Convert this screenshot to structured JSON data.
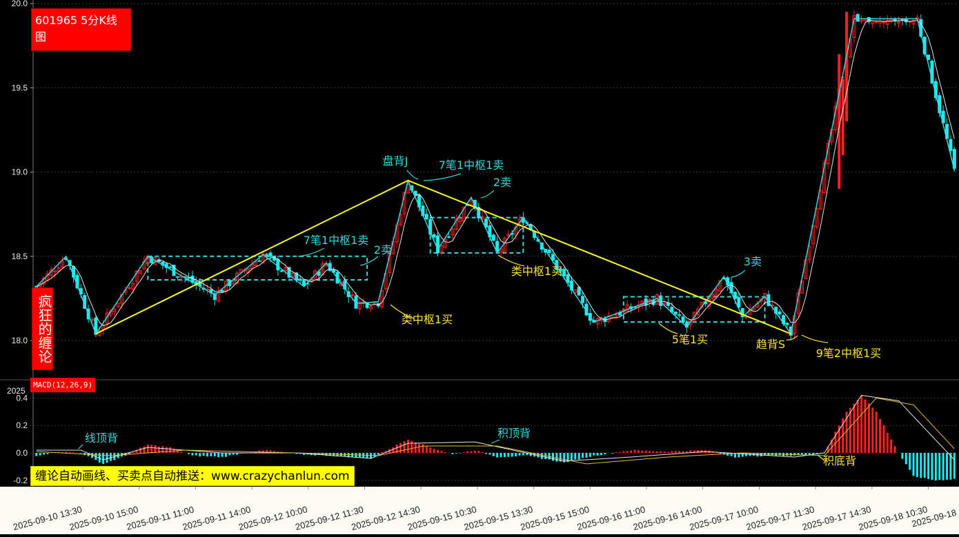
{
  "stock_title": "601965 5分K线图",
  "side_badge": "疯狂的缠论",
  "macd_label": "MACD(12,26,9)",
  "promo_text": "缠论自动画线、买卖点自动推送：www.crazychanlun.com",
  "colors": {
    "background": "#000000",
    "up_candle": "#ff2020",
    "down_candle": "#22e8f0",
    "stroke_lines": "#35d8dc",
    "segment_lines": "#ffff20",
    "zone_boxes": "#35d8dc",
    "annotation_cyan": "#35d8dc",
    "annotation_yellow": "#ffe040",
    "ma_line": "#e8e8e8",
    "dif_line": "#e8e8e8",
    "dea_line": "#e0c030"
  },
  "chart_data": [
    {
      "type": "candlestick",
      "name": "price",
      "y_ticks": [
        "20.0",
        "19.5",
        "19.0",
        "18.5",
        "18.0"
      ],
      "ylim": [
        17.8,
        20.0
      ],
      "x_ticks": [
        "2025-09-10 13:30",
        "2025-09-10 15:00",
        "2025-09-11 11:00",
        "2025-09-11 14:00",
        "2025-09-12 10:00",
        "2025-09-12 11:30",
        "2025-09-12 14:30",
        "2025-09-15 10:30",
        "2025-09-15 13:30",
        "2025-09-15 15:00",
        "2025-09-16 11:00",
        "2025-09-16 14:00",
        "2025-09-17 10:00",
        "2025-09-17 11:30",
        "2025-09-17 14:30",
        "2025-09-18 10:30",
        "2025-09-18"
      ],
      "extra_tick": "2025",
      "stroke_points": [
        {
          "i": 0,
          "v": 18.32
        },
        {
          "i": 8,
          "v": 18.5
        },
        {
          "i": 16,
          "v": 18.04
        },
        {
          "i": 30,
          "v": 18.5
        },
        {
          "i": 48,
          "v": 18.27
        },
        {
          "i": 61,
          "v": 18.51
        },
        {
          "i": 72,
          "v": 18.32
        },
        {
          "i": 78,
          "v": 18.46
        },
        {
          "i": 86,
          "v": 18.22
        },
        {
          "i": 92,
          "v": 18.23
        },
        {
          "i": 100,
          "v": 18.95
        },
        {
          "i": 108,
          "v": 18.54
        },
        {
          "i": 117,
          "v": 18.85
        },
        {
          "i": 124,
          "v": 18.52
        },
        {
          "i": 131,
          "v": 18.73
        },
        {
          "i": 150,
          "v": 18.11
        },
        {
          "i": 167,
          "v": 18.25
        },
        {
          "i": 175,
          "v": 18.08
        },
        {
          "i": 185,
          "v": 18.38
        },
        {
          "i": 190,
          "v": 18.14
        },
        {
          "i": 196,
          "v": 18.26
        },
        {
          "i": 203,
          "v": 18.04
        },
        {
          "i": 220,
          "v": 19.91
        },
        {
          "i": 237,
          "v": 19.91
        },
        {
          "i": 247,
          "v": 19.01
        }
      ],
      "segment_points": [
        {
          "i": 16,
          "v": 18.04
        },
        {
          "i": 100,
          "v": 18.95
        },
        {
          "i": 203,
          "v": 18.04
        }
      ],
      "zones": [
        {
          "i0": 30,
          "i1": 89,
          "lo": 18.36,
          "hi": 18.5
        },
        {
          "i0": 106,
          "i1": 131,
          "lo": 18.52,
          "hi": 18.73
        },
        {
          "i0": 158,
          "i1": 196,
          "lo": 18.11,
          "hi": 18.26
        }
      ],
      "annotations": [
        {
          "text": "7笔1中枢1卖",
          "color": "cyan"
        },
        {
          "text": "2卖",
          "color": "cyan"
        },
        {
          "text": "类中枢1买",
          "color": "yellow"
        },
        {
          "text": "盘背J",
          "color": "cyan"
        },
        {
          "text": "7笔1中枢1卖",
          "color": "cyan"
        },
        {
          "text": "2卖",
          "color": "cyan"
        },
        {
          "text": "类中枢1买",
          "color": "yellow"
        },
        {
          "text": "3卖",
          "color": "cyan"
        },
        {
          "text": "5笔1买",
          "color": "yellow"
        },
        {
          "text": "趋背S",
          "color": "yellow"
        },
        {
          "text": "9笔2中枢1买",
          "color": "yellow"
        }
      ]
    },
    {
      "type": "bar",
      "name": "MACD",
      "y_ticks": [
        "0.4",
        "0.2",
        "0.0",
        "-0.2"
      ],
      "ylim": [
        -0.25,
        0.45
      ],
      "hist_keypoints": [
        {
          "i": 0,
          "v": -0.02
        },
        {
          "i": 6,
          "v": 0.01
        },
        {
          "i": 12,
          "v": 0.0
        },
        {
          "i": 18,
          "v": -0.08
        },
        {
          "i": 24,
          "v": -0.02
        },
        {
          "i": 30,
          "v": 0.06
        },
        {
          "i": 36,
          "v": 0.04
        },
        {
          "i": 42,
          "v": -0.02
        },
        {
          "i": 50,
          "v": -0.03
        },
        {
          "i": 56,
          "v": 0.0
        },
        {
          "i": 62,
          "v": 0.02
        },
        {
          "i": 70,
          "v": -0.01
        },
        {
          "i": 80,
          "v": -0.02
        },
        {
          "i": 90,
          "v": -0.04
        },
        {
          "i": 100,
          "v": 0.1
        },
        {
          "i": 106,
          "v": 0.04
        },
        {
          "i": 112,
          "v": -0.01
        },
        {
          "i": 118,
          "v": 0.02
        },
        {
          "i": 124,
          "v": -0.03
        },
        {
          "i": 132,
          "v": -0.02
        },
        {
          "i": 142,
          "v": -0.07
        },
        {
          "i": 150,
          "v": -0.02
        },
        {
          "i": 160,
          "v": 0.02
        },
        {
          "i": 170,
          "v": 0.01
        },
        {
          "i": 180,
          "v": 0.02
        },
        {
          "i": 188,
          "v": -0.03
        },
        {
          "i": 196,
          "v": -0.02
        },
        {
          "i": 204,
          "v": -0.02
        },
        {
          "i": 212,
          "v": 0.0
        },
        {
          "i": 218,
          "v": 0.3
        },
        {
          "i": 222,
          "v": 0.42
        },
        {
          "i": 226,
          "v": 0.3
        },
        {
          "i": 232,
          "v": 0.0
        },
        {
          "i": 236,
          "v": -0.17
        },
        {
          "i": 242,
          "v": -0.2
        },
        {
          "i": 247,
          "v": -0.19
        }
      ],
      "dif_keypoints": [
        {
          "i": 0,
          "v": 0.02
        },
        {
          "i": 12,
          "v": 0.02
        },
        {
          "i": 18,
          "v": -0.05
        },
        {
          "i": 30,
          "v": 0.04
        },
        {
          "i": 50,
          "v": 0.0
        },
        {
          "i": 70,
          "v": 0.0
        },
        {
          "i": 90,
          "v": -0.04
        },
        {
          "i": 100,
          "v": 0.07
        },
        {
          "i": 118,
          "v": 0.08
        },
        {
          "i": 142,
          "v": -0.06
        },
        {
          "i": 160,
          "v": -0.03
        },
        {
          "i": 180,
          "v": 0.01
        },
        {
          "i": 204,
          "v": -0.03
        },
        {
          "i": 212,
          "v": 0.0
        },
        {
          "i": 222,
          "v": 0.42
        },
        {
          "i": 232,
          "v": 0.38
        },
        {
          "i": 247,
          "v": -0.05
        }
      ],
      "dea_keypoints": [
        {
          "i": 0,
          "v": 0.01
        },
        {
          "i": 20,
          "v": -0.02
        },
        {
          "i": 40,
          "v": 0.02
        },
        {
          "i": 70,
          "v": 0.0
        },
        {
          "i": 92,
          "v": -0.02
        },
        {
          "i": 104,
          "v": 0.05
        },
        {
          "i": 124,
          "v": 0.05
        },
        {
          "i": 148,
          "v": -0.08
        },
        {
          "i": 170,
          "v": -0.03
        },
        {
          "i": 190,
          "v": 0.0
        },
        {
          "i": 212,
          "v": -0.02
        },
        {
          "i": 226,
          "v": 0.4
        },
        {
          "i": 236,
          "v": 0.35
        },
        {
          "i": 247,
          "v": 0.03
        }
      ],
      "annotations": [
        {
          "text": "线顶背",
          "color": "cyan"
        },
        {
          "text": "积顶背",
          "color": "cyan"
        },
        {
          "text": "积底背",
          "color": "yellow"
        }
      ]
    }
  ]
}
